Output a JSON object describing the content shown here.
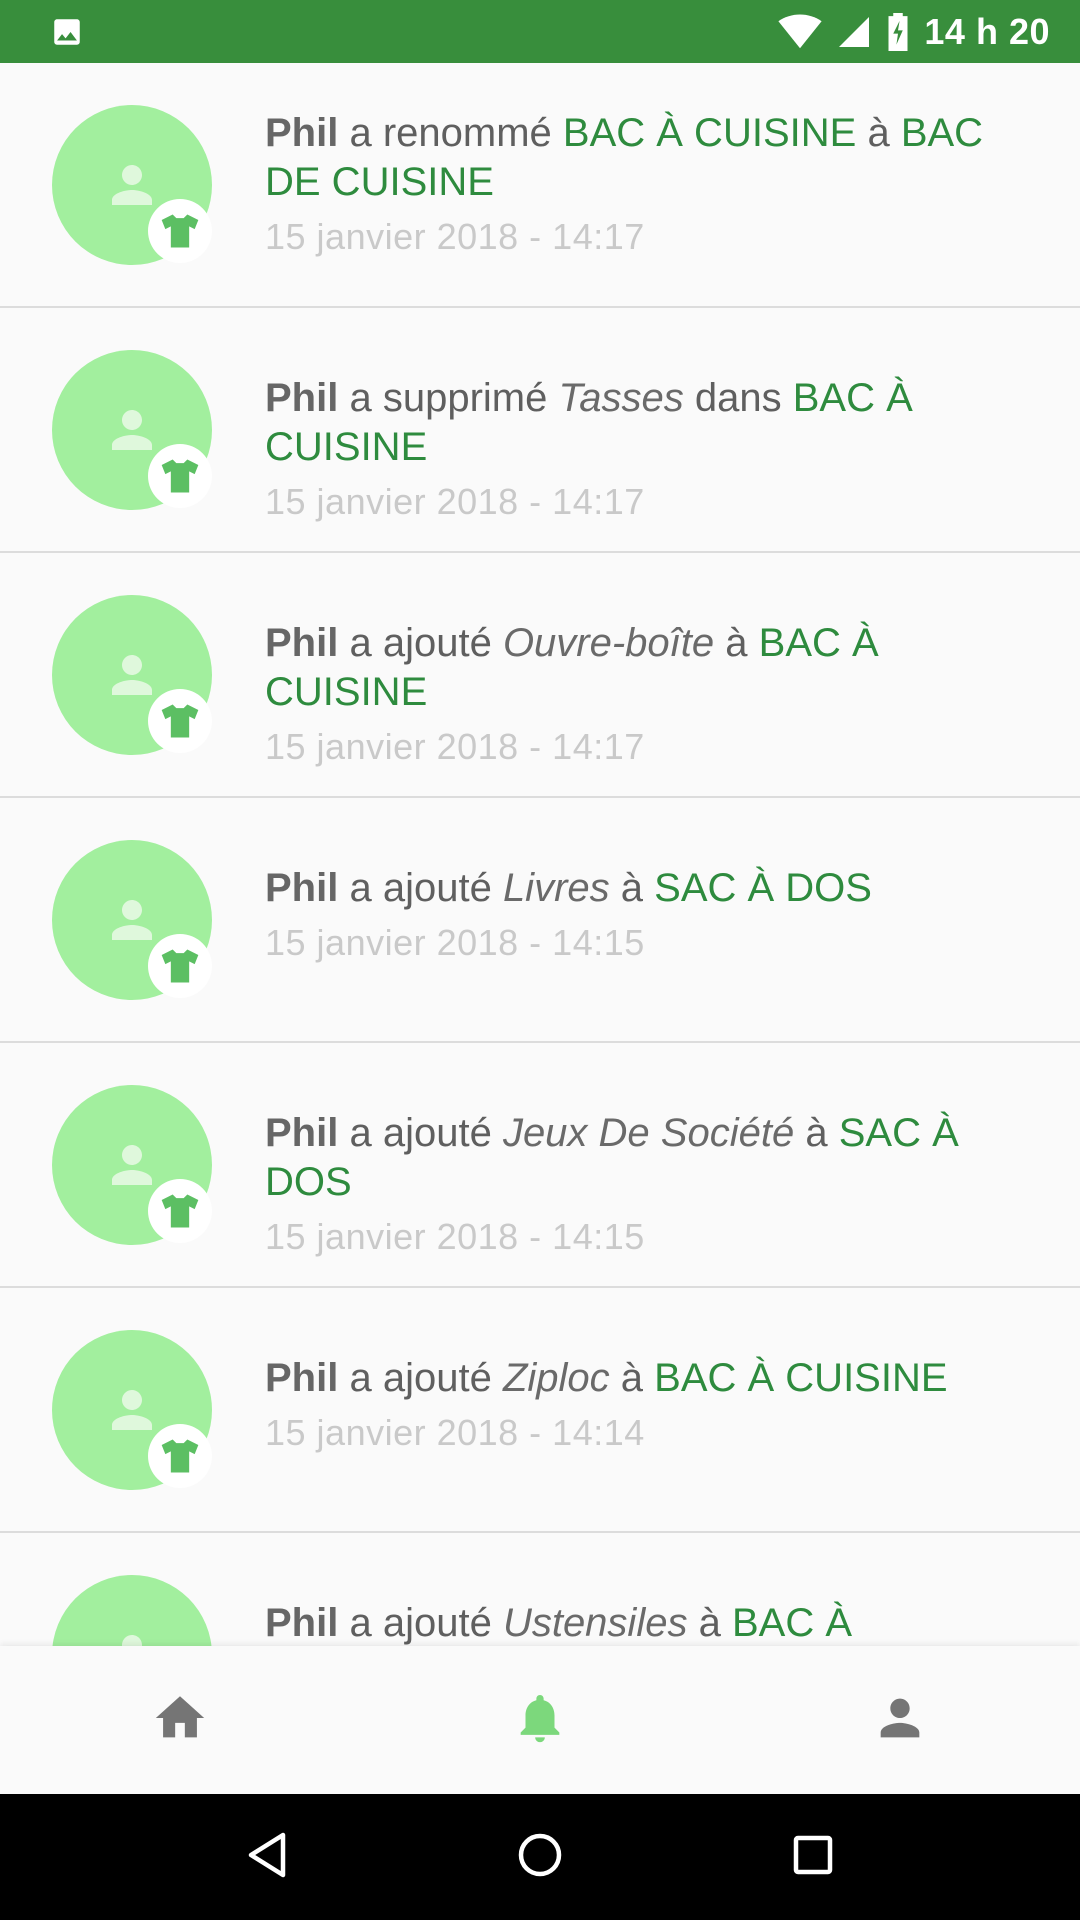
{
  "status_bar": {
    "time": "14 h 20",
    "icons": [
      "image-icon",
      "wifi-icon",
      "signal-icon",
      "battery-charging-icon"
    ],
    "background": "#388e3c"
  },
  "feed": {
    "items": [
      {
        "actor": "Phil",
        "verb": "a renommé",
        "item": "",
        "connector_before_target": "",
        "target": "BAC À CUISINE",
        "connector_after_target": "à",
        "target2": "BAC DE CUISINE",
        "timestamp": "15 janvier 2018 - 14:17"
      },
      {
        "actor": "Phil",
        "verb": "a supprimé",
        "item": "Tasses",
        "connector_before_target": "dans",
        "target": "BAC À CUISINE",
        "connector_after_target": "",
        "target2": "",
        "timestamp": "15 janvier 2018 - 14:17"
      },
      {
        "actor": "Phil",
        "verb": "a ajouté",
        "item": "Ouvre-boîte",
        "connector_before_target": "à",
        "target": "BAC À CUISINE",
        "connector_after_target": "",
        "target2": "",
        "timestamp": "15 janvier 2018 - 14:17"
      },
      {
        "actor": "Phil",
        "verb": "a ajouté",
        "item": "Livres",
        "connector_before_target": "à",
        "target": "SAC À DOS",
        "connector_after_target": "",
        "target2": "",
        "timestamp": "15 janvier 2018 - 14:15"
      },
      {
        "actor": "Phil",
        "verb": "a ajouté",
        "item": "Jeux De Société",
        "connector_before_target": "à",
        "target": "SAC À DOS",
        "connector_after_target": "",
        "target2": "",
        "timestamp": "15 janvier 2018 - 14:15"
      },
      {
        "actor": "Phil",
        "verb": "a ajouté",
        "item": "Ziploc",
        "connector_before_target": "à",
        "target": "BAC À CUISINE",
        "connector_after_target": "",
        "target2": "",
        "timestamp": "15 janvier 2018 - 14:14"
      },
      {
        "actor": "Phil",
        "verb": "a ajouté",
        "item": "Ustensiles",
        "connector_before_target": "à",
        "target": "BAC À CUISINE",
        "connector_after_target": "",
        "target2": "",
        "timestamp": ""
      }
    ]
  },
  "bottom_nav": {
    "items": [
      {
        "icon": "home-icon",
        "active": false
      },
      {
        "icon": "bell-icon",
        "active": true
      },
      {
        "icon": "person-icon",
        "active": false
      }
    ],
    "active_color": "#7cd87c",
    "inactive_color": "#757575"
  },
  "system_nav": {
    "icons": [
      "back-icon",
      "home-circle-icon",
      "recents-icon"
    ]
  },
  "colors": {
    "accent": "#2e8b3e",
    "avatar_bg": "#a2ef9e",
    "badge_icon": "#5cbf63",
    "timestamp": "#c9c9c9"
  }
}
